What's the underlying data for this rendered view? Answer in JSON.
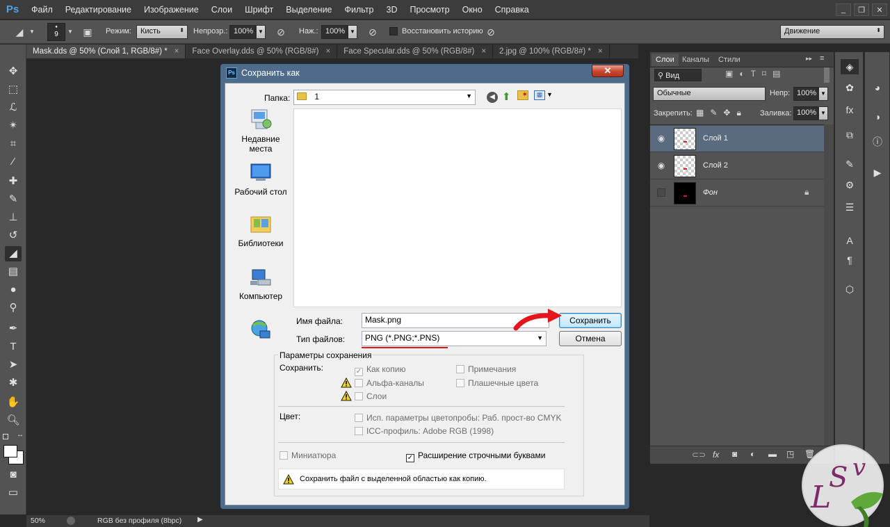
{
  "menubar": {
    "logo": "Ps",
    "items": [
      "Файл",
      "Редактирование",
      "Изображение",
      "Слои",
      "Шрифт",
      "Выделение",
      "Фильтр",
      "3D",
      "Просмотр",
      "Окно",
      "Справка"
    ]
  },
  "optionsbar": {
    "brush_size": "9",
    "mode_label": "Режим:",
    "mode_value": "Кисть",
    "opacity_label": "Непрозр.:",
    "opacity_value": "100%",
    "pressure_label": "Наж.:",
    "pressure_value": "100%",
    "restore_history": "Восстановить историю",
    "workspace": "Движение"
  },
  "tabs": [
    {
      "label": "Mask.dds @ 50% (Слой 1, RGB/8#) *",
      "active": true
    },
    {
      "label": "Face Overlay.dds @ 50% (RGB/8#)",
      "active": false
    },
    {
      "label": "Face Specular.dds @ 50% (RGB/8#)",
      "active": false
    },
    {
      "label": "2.jpg @ 100% (RGB/8#) *",
      "active": false
    }
  ],
  "statusbar": {
    "zoom": "50%",
    "profile": "RGB без профиля (8bpc)"
  },
  "layers_panel": {
    "tabs": [
      "Слои",
      "Каналы",
      "Стили"
    ],
    "filter_kind": "Вид",
    "blend_mode": "Обычные",
    "opacity_label": "Непр:",
    "opacity_value": "100%",
    "lock_label": "Закрепить:",
    "fill_label": "Заливка:",
    "fill_value": "100%",
    "layers": [
      {
        "name": "Слой 1",
        "selected": true,
        "visible": true
      },
      {
        "name": "Слой 2",
        "selected": false,
        "visible": true
      },
      {
        "name": "Фон",
        "selected": false,
        "visible": false,
        "locked": true
      }
    ]
  },
  "dialog": {
    "title": "Сохранить как",
    "folder_label": "Папка:",
    "folder_value": "1",
    "places": [
      "Недавние места",
      "Рабочий стол",
      "Библиотеки",
      "Компьютер"
    ],
    "filename_label": "Имя файла:",
    "filename_value": "Mask.png",
    "filetype_label": "Тип файлов:",
    "filetype_value": "PNG (*.PNG;*.PNS)",
    "save_button": "Сохранить",
    "cancel_button": "Отмена",
    "options_group": "Параметры сохранения",
    "save_label": "Сохранить:",
    "opt_as_copy": "Как копию",
    "opt_alpha": "Альфа-каналы",
    "opt_layers": "Слои",
    "opt_notes": "Примечания",
    "opt_spot": "Плашечные цвета",
    "color_label": "Цвет:",
    "opt_proof": "Исп. параметры цветопробы:  Раб. прост-во CMYK",
    "opt_icc": "ICC-профиль:  Adobe RGB (1998)",
    "opt_thumbnail": "Миниатюра",
    "opt_lowercase": "Расширение строчными буквами",
    "warning_text": "Сохранить файл с выделенной областью как копию."
  },
  "watermark": {
    "text": "LSV"
  },
  "colors": {
    "accent_red": "#e3161b",
    "selected_layer": "#5a6b80",
    "dialog_frame": "#4e6b8b"
  }
}
